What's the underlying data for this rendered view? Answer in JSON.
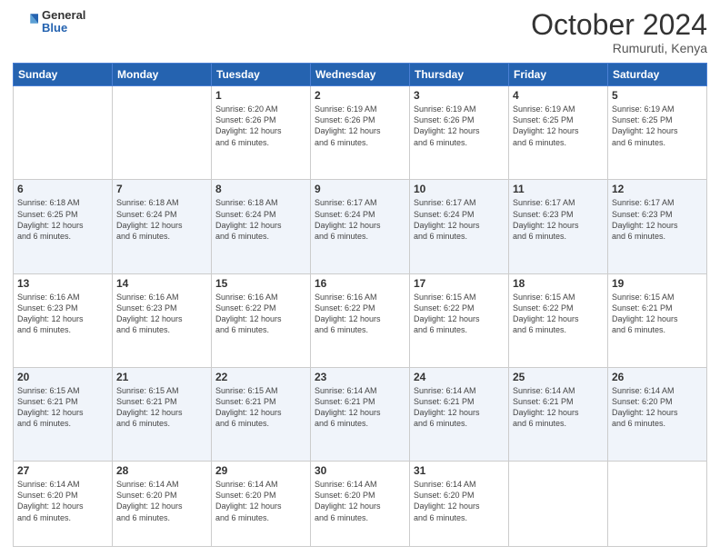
{
  "logo": {
    "general": "General",
    "blue": "Blue"
  },
  "header": {
    "month": "October 2024",
    "location": "Rumuruti, Kenya"
  },
  "weekdays": [
    "Sunday",
    "Monday",
    "Tuesday",
    "Wednesday",
    "Thursday",
    "Friday",
    "Saturday"
  ],
  "weeks": [
    [
      {
        "day": "",
        "empty": true
      },
      {
        "day": "",
        "empty": true
      },
      {
        "day": "1",
        "sunrise": "Sunrise: 6:20 AM",
        "sunset": "Sunset: 6:26 PM",
        "daylight": "Daylight: 12 hours and 6 minutes."
      },
      {
        "day": "2",
        "sunrise": "Sunrise: 6:19 AM",
        "sunset": "Sunset: 6:26 PM",
        "daylight": "Daylight: 12 hours and 6 minutes."
      },
      {
        "day": "3",
        "sunrise": "Sunrise: 6:19 AM",
        "sunset": "Sunset: 6:26 PM",
        "daylight": "Daylight: 12 hours and 6 minutes."
      },
      {
        "day": "4",
        "sunrise": "Sunrise: 6:19 AM",
        "sunset": "Sunset: 6:25 PM",
        "daylight": "Daylight: 12 hours and 6 minutes."
      },
      {
        "day": "5",
        "sunrise": "Sunrise: 6:19 AM",
        "sunset": "Sunset: 6:25 PM",
        "daylight": "Daylight: 12 hours and 6 minutes."
      }
    ],
    [
      {
        "day": "6",
        "sunrise": "Sunrise: 6:18 AM",
        "sunset": "Sunset: 6:25 PM",
        "daylight": "Daylight: 12 hours and 6 minutes."
      },
      {
        "day": "7",
        "sunrise": "Sunrise: 6:18 AM",
        "sunset": "Sunset: 6:24 PM",
        "daylight": "Daylight: 12 hours and 6 minutes."
      },
      {
        "day": "8",
        "sunrise": "Sunrise: 6:18 AM",
        "sunset": "Sunset: 6:24 PM",
        "daylight": "Daylight: 12 hours and 6 minutes."
      },
      {
        "day": "9",
        "sunrise": "Sunrise: 6:17 AM",
        "sunset": "Sunset: 6:24 PM",
        "daylight": "Daylight: 12 hours and 6 minutes."
      },
      {
        "day": "10",
        "sunrise": "Sunrise: 6:17 AM",
        "sunset": "Sunset: 6:24 PM",
        "daylight": "Daylight: 12 hours and 6 minutes."
      },
      {
        "day": "11",
        "sunrise": "Sunrise: 6:17 AM",
        "sunset": "Sunset: 6:23 PM",
        "daylight": "Daylight: 12 hours and 6 minutes."
      },
      {
        "day": "12",
        "sunrise": "Sunrise: 6:17 AM",
        "sunset": "Sunset: 6:23 PM",
        "daylight": "Daylight: 12 hours and 6 minutes."
      }
    ],
    [
      {
        "day": "13",
        "sunrise": "Sunrise: 6:16 AM",
        "sunset": "Sunset: 6:23 PM",
        "daylight": "Daylight: 12 hours and 6 minutes."
      },
      {
        "day": "14",
        "sunrise": "Sunrise: 6:16 AM",
        "sunset": "Sunset: 6:23 PM",
        "daylight": "Daylight: 12 hours and 6 minutes."
      },
      {
        "day": "15",
        "sunrise": "Sunrise: 6:16 AM",
        "sunset": "Sunset: 6:22 PM",
        "daylight": "Daylight: 12 hours and 6 minutes."
      },
      {
        "day": "16",
        "sunrise": "Sunrise: 6:16 AM",
        "sunset": "Sunset: 6:22 PM",
        "daylight": "Daylight: 12 hours and 6 minutes."
      },
      {
        "day": "17",
        "sunrise": "Sunrise: 6:15 AM",
        "sunset": "Sunset: 6:22 PM",
        "daylight": "Daylight: 12 hours and 6 minutes."
      },
      {
        "day": "18",
        "sunrise": "Sunrise: 6:15 AM",
        "sunset": "Sunset: 6:22 PM",
        "daylight": "Daylight: 12 hours and 6 minutes."
      },
      {
        "day": "19",
        "sunrise": "Sunrise: 6:15 AM",
        "sunset": "Sunset: 6:21 PM",
        "daylight": "Daylight: 12 hours and 6 minutes."
      }
    ],
    [
      {
        "day": "20",
        "sunrise": "Sunrise: 6:15 AM",
        "sunset": "Sunset: 6:21 PM",
        "daylight": "Daylight: 12 hours and 6 minutes."
      },
      {
        "day": "21",
        "sunrise": "Sunrise: 6:15 AM",
        "sunset": "Sunset: 6:21 PM",
        "daylight": "Daylight: 12 hours and 6 minutes."
      },
      {
        "day": "22",
        "sunrise": "Sunrise: 6:15 AM",
        "sunset": "Sunset: 6:21 PM",
        "daylight": "Daylight: 12 hours and 6 minutes."
      },
      {
        "day": "23",
        "sunrise": "Sunrise: 6:14 AM",
        "sunset": "Sunset: 6:21 PM",
        "daylight": "Daylight: 12 hours and 6 minutes."
      },
      {
        "day": "24",
        "sunrise": "Sunrise: 6:14 AM",
        "sunset": "Sunset: 6:21 PM",
        "daylight": "Daylight: 12 hours and 6 minutes."
      },
      {
        "day": "25",
        "sunrise": "Sunrise: 6:14 AM",
        "sunset": "Sunset: 6:21 PM",
        "daylight": "Daylight: 12 hours and 6 minutes."
      },
      {
        "day": "26",
        "sunrise": "Sunrise: 6:14 AM",
        "sunset": "Sunset: 6:20 PM",
        "daylight": "Daylight: 12 hours and 6 minutes."
      }
    ],
    [
      {
        "day": "27",
        "sunrise": "Sunrise: 6:14 AM",
        "sunset": "Sunset: 6:20 PM",
        "daylight": "Daylight: 12 hours and 6 minutes."
      },
      {
        "day": "28",
        "sunrise": "Sunrise: 6:14 AM",
        "sunset": "Sunset: 6:20 PM",
        "daylight": "Daylight: 12 hours and 6 minutes."
      },
      {
        "day": "29",
        "sunrise": "Sunrise: 6:14 AM",
        "sunset": "Sunset: 6:20 PM",
        "daylight": "Daylight: 12 hours and 6 minutes."
      },
      {
        "day": "30",
        "sunrise": "Sunrise: 6:14 AM",
        "sunset": "Sunset: 6:20 PM",
        "daylight": "Daylight: 12 hours and 6 minutes."
      },
      {
        "day": "31",
        "sunrise": "Sunrise: 6:14 AM",
        "sunset": "Sunset: 6:20 PM",
        "daylight": "Daylight: 12 hours and 6 minutes."
      },
      {
        "day": "",
        "empty": true
      },
      {
        "day": "",
        "empty": true
      }
    ]
  ]
}
